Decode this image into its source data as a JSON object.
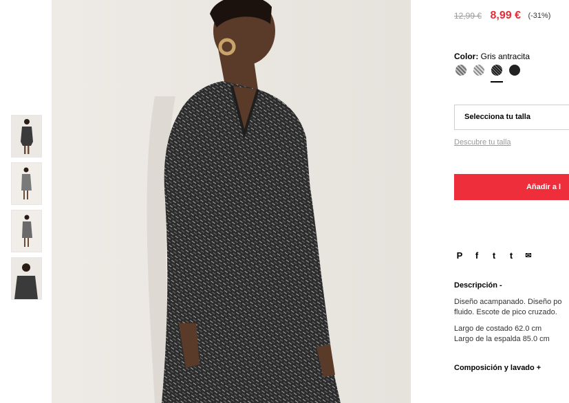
{
  "thumbnails": [
    {
      "alt": "thumbnail-1"
    },
    {
      "alt": "thumbnail-2"
    },
    {
      "alt": "thumbnail-3"
    },
    {
      "alt": "thumbnail-4"
    }
  ],
  "product": {
    "old_price": "12,99 €",
    "new_price": "8,99 €",
    "discount": "(-31%)",
    "color_label": "Color:",
    "color_value": "Gris antracita",
    "swatches": [
      {
        "icon": "pattern-swatch-light",
        "color": "#9a9a9a"
      },
      {
        "icon": "pattern-swatch-medium",
        "color": "#b8b8b8"
      },
      {
        "icon": "pattern-swatch-dark",
        "color": "#3a3a3a",
        "selected": true
      },
      {
        "icon": "solid-swatch-black",
        "color": "#222222"
      }
    ],
    "size_placeholder": "Selecciona tu talla",
    "size_link": "Descubre tu talla",
    "add_button": "Añadir a l"
  },
  "share_icons": [
    {
      "icon": "pinterest-icon",
      "glyph": "P"
    },
    {
      "icon": "facebook-icon",
      "glyph": "f"
    },
    {
      "icon": "twitter-icon",
      "glyph": "t"
    },
    {
      "icon": "tumblr-icon",
      "glyph": "t"
    },
    {
      "icon": "mail-icon",
      "glyph": "✉"
    }
  ],
  "description": {
    "title": "Descripción  -",
    "line1": "Diseño acampanado. Diseño po",
    "line2": "fluido. Escote de pico cruzado.",
    "line3": "Largo de costado 62.0 cm",
    "line4": "Largo de la espalda 85.0 cm"
  },
  "composition": {
    "title": "Composición y lavado  +"
  },
  "colors": {
    "accent": "#ee2e3b",
    "price": "#e52b35"
  }
}
